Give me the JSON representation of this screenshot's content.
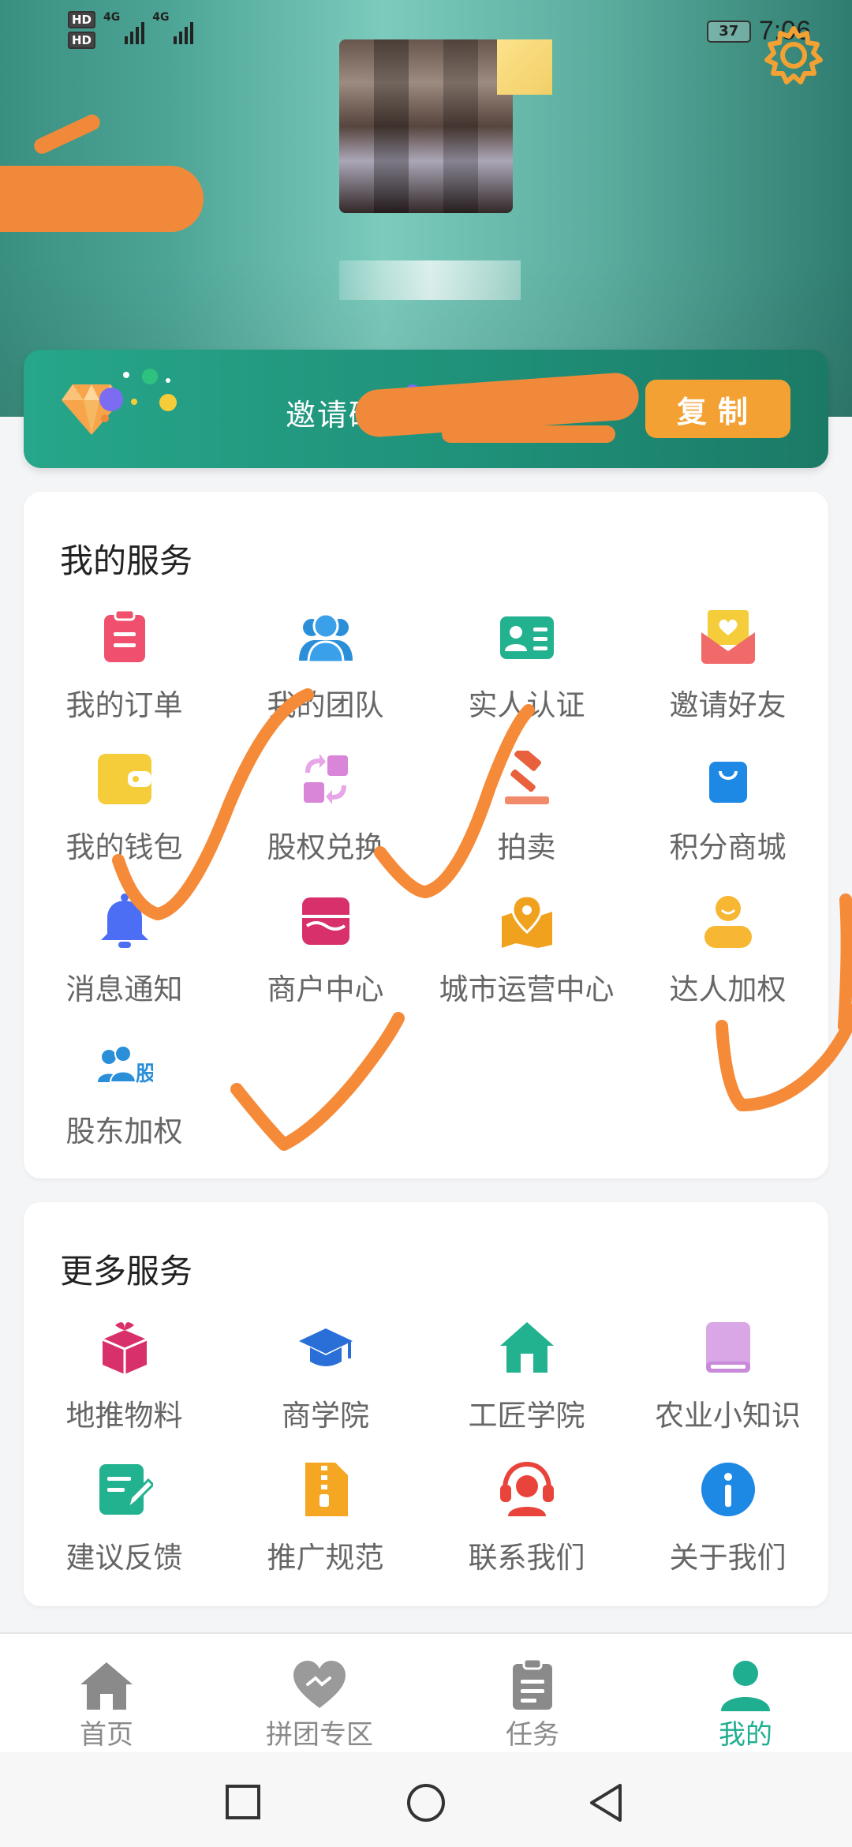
{
  "status_bar": {
    "hd_labels": [
      "HD",
      "HD"
    ],
    "network_labels": [
      "4G",
      "4G"
    ],
    "battery": "37",
    "time": "7:06"
  },
  "header": {
    "settings_icon": "gear-icon",
    "colors": {
      "gradient_start": "#3a8f80",
      "gradient_mid": "#7ccbbd",
      "gradient_end": "#2f7d70",
      "redaction": "#f08a3a"
    }
  },
  "invite": {
    "label": "邀请码",
    "copy_button": "复制",
    "colors": {
      "bar": "#1f8f78",
      "button": "#f3a133"
    }
  },
  "my_services": {
    "title": "我的服务",
    "items": [
      {
        "label": "我的订单",
        "icon": "clipboard-icon",
        "color": "#f0506e"
      },
      {
        "label": "我的团队",
        "icon": "team-icon",
        "color": "#2a8fd8"
      },
      {
        "label": "实人认证",
        "icon": "id-card-icon",
        "color": "#23b28f"
      },
      {
        "label": "邀请好友",
        "icon": "envelope-heart-icon",
        "color": "#f06a6a"
      },
      {
        "label": "我的钱包",
        "icon": "wallet-icon",
        "color": "#f5cd3a"
      },
      {
        "label": "股权兑换",
        "icon": "exchange-icon",
        "color": "#d986d9"
      },
      {
        "label": "拍卖",
        "icon": "gavel-icon",
        "color": "#e8603c"
      },
      {
        "label": "积分商城",
        "icon": "shopping-bag-icon",
        "color": "#1e88e5"
      },
      {
        "label": "消息通知",
        "icon": "bell-icon",
        "color": "#4b6ef5"
      },
      {
        "label": "商户中心",
        "icon": "store-icon",
        "color": "#d8306a"
      },
      {
        "label": "城市运营中心",
        "icon": "map-pin-icon",
        "color": "#f0a21f"
      },
      {
        "label": "达人加权",
        "icon": "person-icon",
        "color": "#f7b733"
      },
      {
        "label": "股东加权",
        "icon": "shareholder-icon",
        "color": "#2a8fd8",
        "badge": "股"
      }
    ]
  },
  "more_services": {
    "title": "更多服务",
    "items": [
      {
        "label": "地推物料",
        "icon": "box-icon",
        "color": "#d8306a"
      },
      {
        "label": "商学院",
        "icon": "graduation-cap-icon",
        "color": "#2a6fd8"
      },
      {
        "label": "工匠学院",
        "icon": "house-icon",
        "color": "#23b28f"
      },
      {
        "label": "农业小知识",
        "icon": "book-icon",
        "color": "#d9a6e6"
      },
      {
        "label": "建议反馈",
        "icon": "edit-note-icon",
        "color": "#23b28f"
      },
      {
        "label": "推广规范",
        "icon": "zip-file-icon",
        "color": "#f5a623"
      },
      {
        "label": "联系我们",
        "icon": "headset-icon",
        "color": "#e8443c"
      },
      {
        "label": "关于我们",
        "icon": "info-icon",
        "color": "#1e88e5",
        "glyph": "i"
      }
    ]
  },
  "bottom_nav": {
    "items": [
      {
        "label": "首页",
        "icon": "home-icon",
        "active": false
      },
      {
        "label": "拼团专区",
        "icon": "heart-icon",
        "active": false
      },
      {
        "label": "任务",
        "icon": "task-clipboard-icon",
        "active": false
      },
      {
        "label": "我的",
        "icon": "user-icon",
        "active": true
      }
    ],
    "colors": {
      "active": "#1fae90",
      "inactive": "#8a8a8a"
    }
  },
  "system_nav": {
    "buttons": [
      "recent-apps-icon",
      "home-circle-icon",
      "back-triangle-icon"
    ]
  }
}
